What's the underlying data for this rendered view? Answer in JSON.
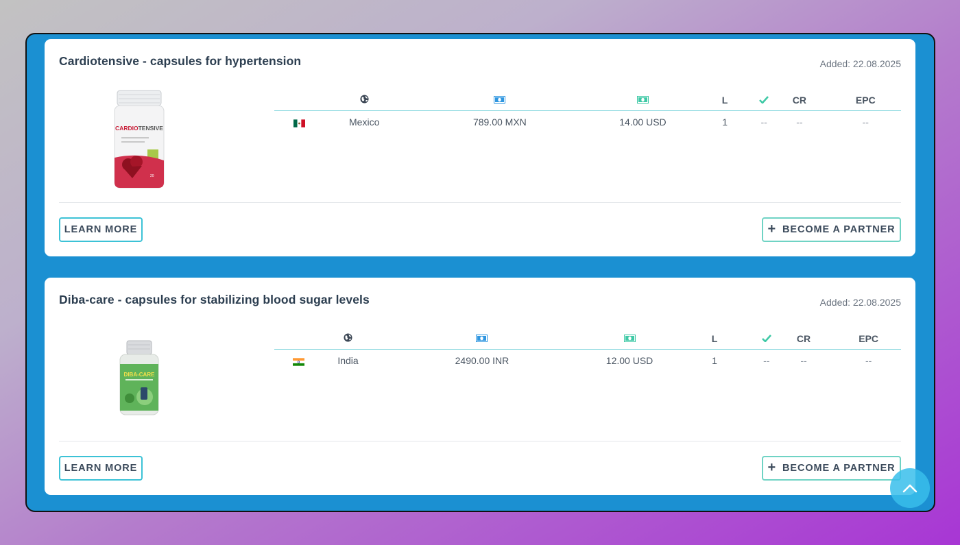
{
  "table_headers": {
    "geo": "globe-icon",
    "price": "money-icon-blue",
    "payout": "money-icon-green",
    "level": "L",
    "approved": "check-icon",
    "cr": "CR",
    "epc": "EPC"
  },
  "buttons": {
    "learn_more": "LEARN MORE",
    "become_partner": "BECOME A PARTNER"
  },
  "offers": [
    {
      "title": "Cardiotensive - capsules for hypertension",
      "added": "Added: 22.08.2025",
      "image_label": "CARDIOTENSIVE",
      "row": {
        "flag": "mexico-flag",
        "country": "Mexico",
        "price": "789.00 MXN",
        "payout": "14.00 USD",
        "level": "1",
        "approved": "--",
        "cr": "--",
        "epc": "--"
      }
    },
    {
      "title": "Diba-care - capsules for stabilizing blood sugar levels",
      "added": "Added: 22.08.2025",
      "image_label": "DIBA-CARE",
      "row": {
        "flag": "india-flag",
        "country": "India",
        "price": "2490.00 INR",
        "payout": "12.00 USD",
        "level": "1",
        "approved": "--",
        "cr": "--",
        "epc": "--"
      }
    }
  ],
  "colors": {
    "frame_bg": "#1b90d2",
    "accent_cyan": "#3cc2d6",
    "accent_green": "#4fd1b0",
    "title_text": "#2c3e50"
  }
}
